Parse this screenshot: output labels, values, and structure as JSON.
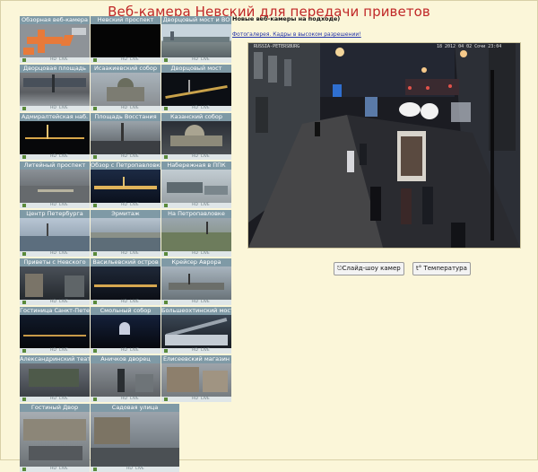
{
  "page": {
    "title": "Веб-камера Невский для передачи приветов"
  },
  "aside": {
    "subheading": "Новые веб-камеры на подходе)",
    "gallery_link": "Фотогалерея. Кадры в высоком разрешении!"
  },
  "thumbnails": [
    [
      "Обзорная веб-камера",
      "Невский проспект",
      "Дворцовый мост и ВО"
    ],
    [
      "Дворцовая площадь",
      "Исаакиевский собор",
      "Дворцовый мост"
    ],
    [
      "Адмиралтейская наб.",
      "Площадь Восстания",
      "Казанский собор"
    ],
    [
      "Литейный проспект",
      "Обзор с Петропавловки",
      "Набережная в ППК"
    ],
    [
      "Центр Петербурга",
      "Эрмитаж",
      "На Петропавловке"
    ],
    [
      "Приветы с Невского",
      "Васильевский остров",
      "Крейсер Аврора"
    ],
    [
      "Гостиница Санкт-Петербург",
      "Смольный собор",
      "Большеохтинский мост"
    ],
    [
      "Александринский театр",
      "Аничков дворец",
      "Елисеевский магазин"
    ],
    [
      "Гостиный Двор",
      "Садовая улица"
    ]
  ],
  "thumb_bar": {
    "hd": "HD",
    "live": "LIVE"
  },
  "main_view": {
    "site_stamp": "RUSSIA-PETERSBURG",
    "timestamp": "18 2012 04 02 Сочи 23:04"
  },
  "buttons": {
    "slideshow": "Слайд-шоу камер",
    "temperature": "t° Температура"
  },
  "colors": {
    "title": "#c02828",
    "background": "#fbf6d9",
    "label_bar": "#7f9aa6"
  }
}
